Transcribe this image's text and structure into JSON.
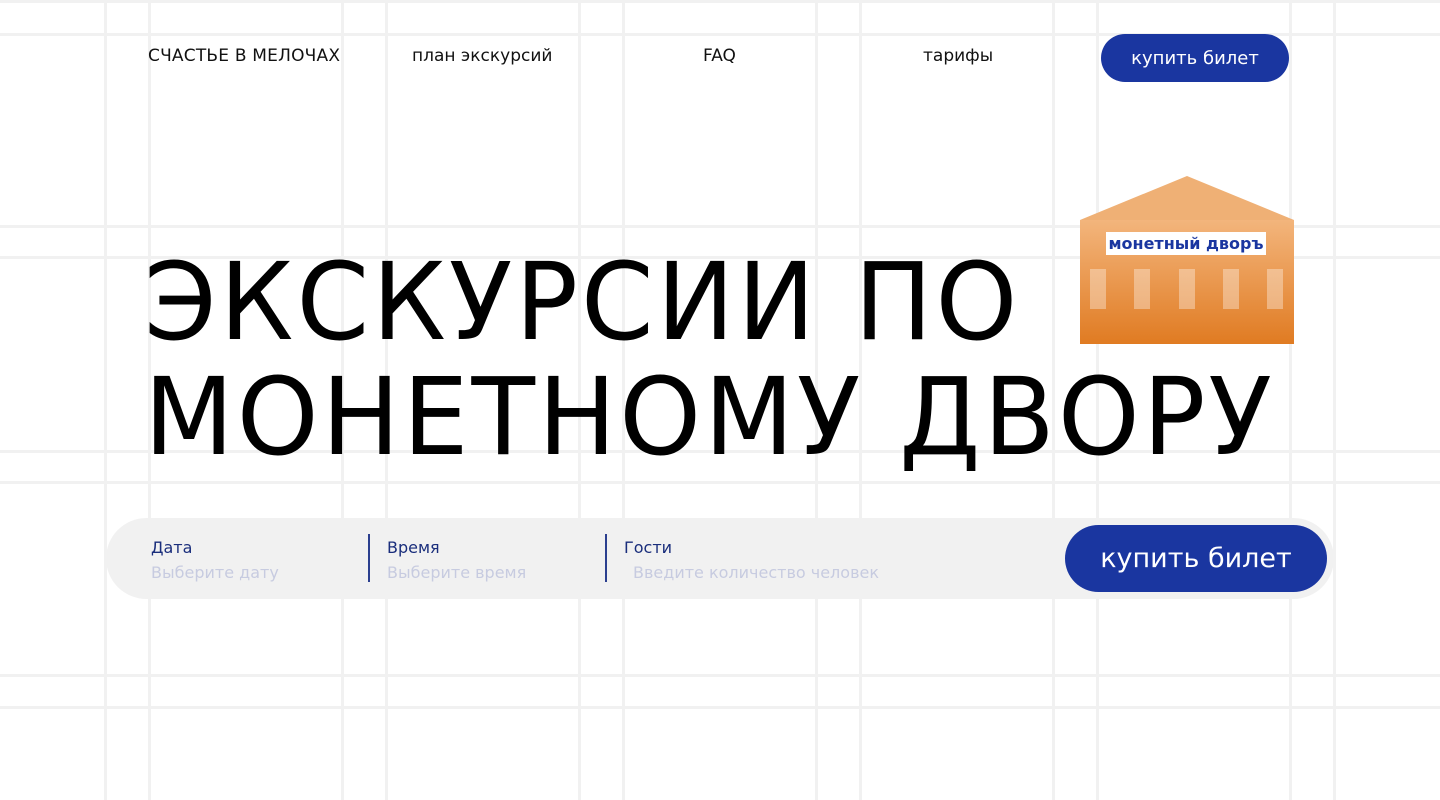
{
  "nav": {
    "logo": "СЧАСТЬЕ В МЕЛОЧАХ",
    "links": [
      "план экскурсий",
      "FAQ",
      "тарифы"
    ],
    "buy_label": "купить билет"
  },
  "hero": {
    "line1": "ЭКСКУРСИИ ПО",
    "line2": "МОНЕТНОМУ ДВОРУ"
  },
  "illustration": {
    "sign_text": "монетный дворъ",
    "roof_color": "#efb075",
    "body_color_top": "#f3b57c",
    "body_color_bottom": "#e07b22",
    "sign_text_color": "#1a36a0"
  },
  "booking": {
    "date": {
      "label": "Дата",
      "placeholder": "Выберите дату"
    },
    "time": {
      "label": "Время",
      "placeholder": "Выберите время"
    },
    "guests": {
      "label": "Гости",
      "placeholder": "Введите количество человек"
    },
    "buy_label": "купить билет"
  },
  "colors": {
    "accent": "#1a36a0",
    "label": "#1a2e7c",
    "bar_bg": "#f1f1f1",
    "grid": "#f1f1f1"
  }
}
